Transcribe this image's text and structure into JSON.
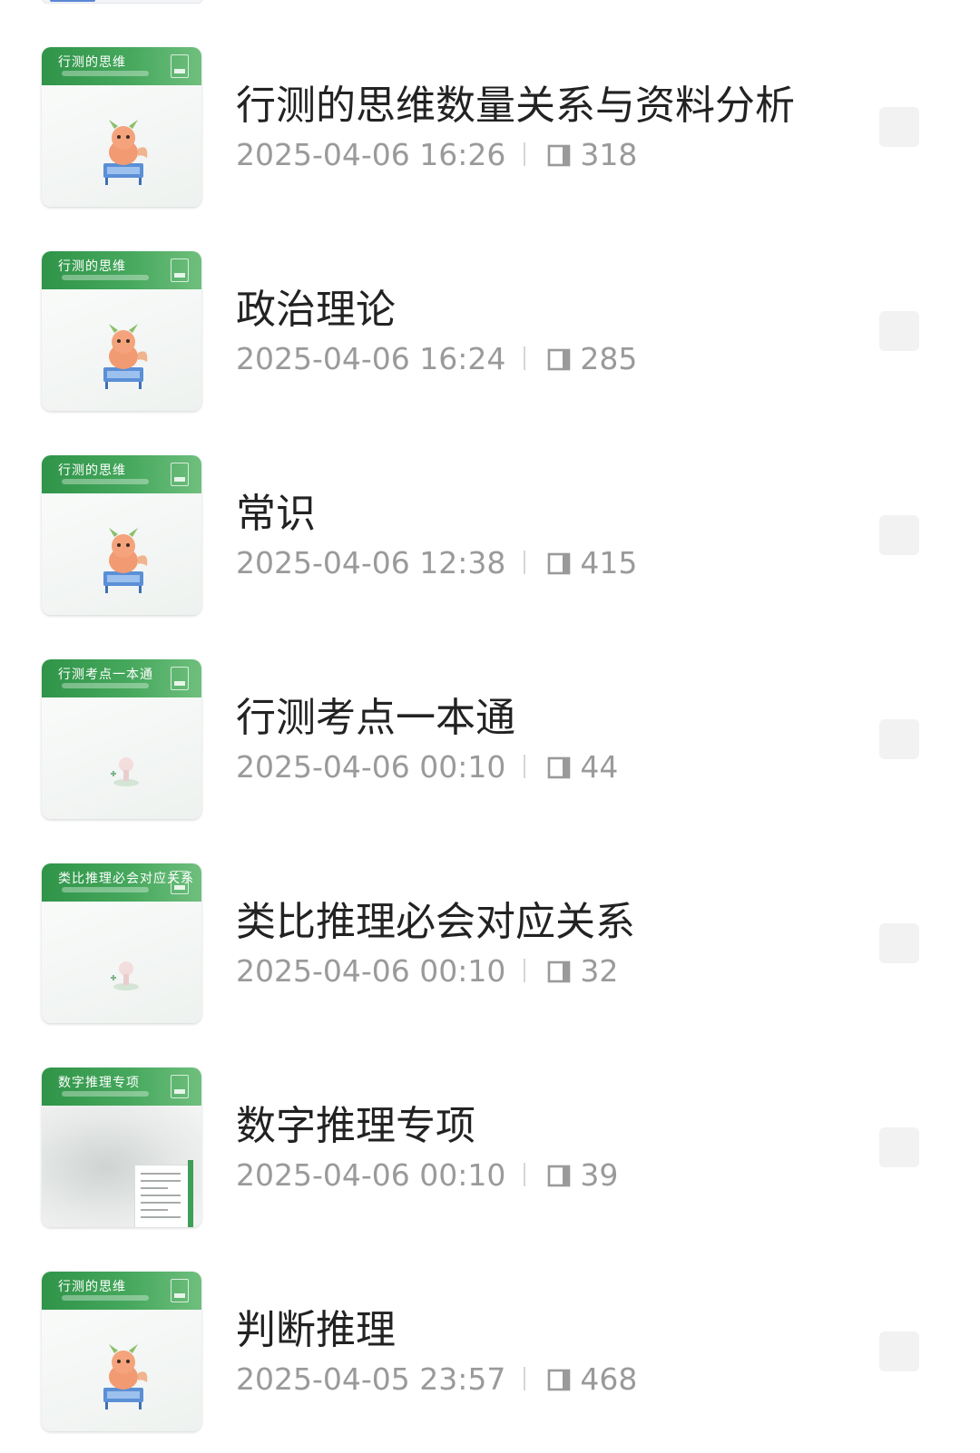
{
  "articles": [
    {
      "title": "行测的思维数量关系与资料分析",
      "date": "2025-04-06 16:26",
      "reads": "318",
      "cover_title": "行测的思维",
      "cover_style": "mascot"
    },
    {
      "title": "政治理论",
      "date": "2025-04-06 16:24",
      "reads": "285",
      "cover_title": "行测的思维",
      "cover_style": "mascot"
    },
    {
      "title": "常识",
      "date": "2025-04-06 12:38",
      "reads": "415",
      "cover_title": "行测的思维",
      "cover_style": "mascot"
    },
    {
      "title": "行测考点一本通",
      "date": "2025-04-06 00:10",
      "reads": "44",
      "cover_title": "行测考点一本通",
      "cover_style": "small"
    },
    {
      "title": "类比推理必会对应关系",
      "date": "2025-04-06 00:10",
      "reads": "32",
      "cover_title": "类比推理必会对应关系",
      "cover_style": "small"
    },
    {
      "title": "数字推理专项",
      "date": "2025-04-06 00:10",
      "reads": "39",
      "cover_title": "数字推理专项",
      "cover_style": "doc"
    },
    {
      "title": "判断推理",
      "date": "2025-04-05 23:57",
      "reads": "468",
      "cover_title": "行测的思维",
      "cover_style": "mascot"
    }
  ],
  "colors": {
    "brand_green": "#3f9e57",
    "title_text": "#222222",
    "meta_text": "#9a9a9a"
  },
  "icons": {
    "reads": "book-icon"
  }
}
